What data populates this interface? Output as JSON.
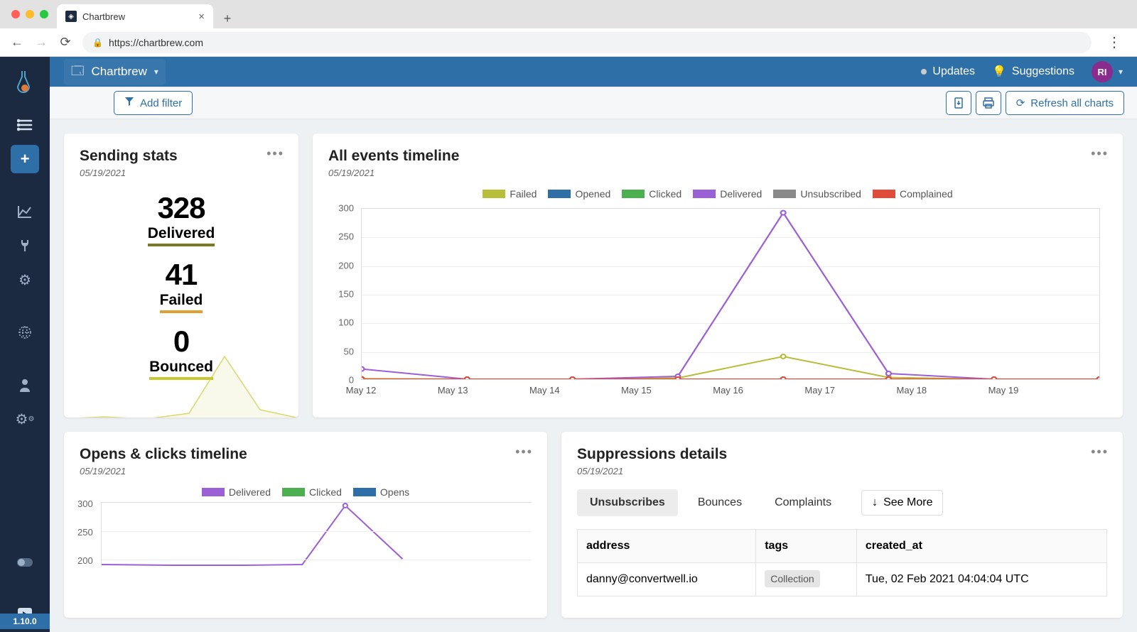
{
  "browser": {
    "tab_title": "Chartbrew",
    "url": "https://chartbrew.com"
  },
  "topbar": {
    "project_name": "Chartbrew",
    "updates_label": "Updates",
    "suggestions_label": "Suggestions",
    "avatar_initials": "RI"
  },
  "toolbar": {
    "add_filter": "Add filter",
    "refresh_label": "Refresh all charts"
  },
  "sidebar": {
    "version": "1.10.0"
  },
  "cards": {
    "sending_stats": {
      "title": "Sending stats",
      "date": "05/19/2021",
      "kpis": [
        {
          "value": "328",
          "label": "Delivered",
          "color": "#7a7a20"
        },
        {
          "value": "41",
          "label": "Failed",
          "color": "#e0a030"
        },
        {
          "value": "0",
          "label": "Bounced",
          "color": "#c8c830"
        }
      ]
    },
    "all_events": {
      "title": "All events timeline",
      "date": "05/19/2021"
    },
    "opens_clicks": {
      "title": "Opens & clicks timeline",
      "date": "05/19/2021",
      "legend": [
        {
          "name": "Delivered",
          "color": "#9b5fd6"
        },
        {
          "name": "Clicked",
          "color": "#4caf50"
        },
        {
          "name": "Opens",
          "color": "#2f6fa7"
        }
      ],
      "yticks": [
        "300",
        "250",
        "200"
      ]
    },
    "suppressions": {
      "title": "Suppressions details",
      "date": "05/19/2021",
      "tabs": [
        "Unsubscribes",
        "Bounces",
        "Complaints"
      ],
      "see_more": "See More",
      "columns": [
        "address",
        "tags",
        "created_at"
      ],
      "rows": [
        {
          "address": "danny@convertwell.io",
          "tag": "Collection",
          "created_at": "Tue, 02 Feb 2021 04:04:04 UTC"
        }
      ]
    }
  },
  "chart_data": {
    "type": "line",
    "title": "All events timeline",
    "categories": [
      "May 12",
      "May 13",
      "May 14",
      "May 15",
      "May 16",
      "May 17",
      "May 18",
      "May 19"
    ],
    "ylim": [
      0,
      300
    ],
    "yticks": [
      0,
      50,
      100,
      150,
      200,
      250,
      300
    ],
    "series": [
      {
        "name": "Failed",
        "color": "#b8bd3a",
        "values": [
          1,
          0,
          0,
          2,
          40,
          3,
          0,
          0
        ]
      },
      {
        "name": "Opened",
        "color": "#2f6fa7",
        "values": [
          0,
          0,
          0,
          0,
          0,
          0,
          0,
          0
        ]
      },
      {
        "name": "Clicked",
        "color": "#4caf50",
        "values": [
          0,
          0,
          0,
          0,
          0,
          0,
          0,
          0
        ]
      },
      {
        "name": "Delivered",
        "color": "#9b5fd6",
        "values": [
          18,
          0,
          0,
          5,
          293,
          10,
          0,
          0
        ]
      },
      {
        "name": "Unsubscribed",
        "color": "#8a8a8a",
        "values": [
          0,
          0,
          0,
          0,
          0,
          0,
          0,
          0
        ]
      },
      {
        "name": "Complained",
        "color": "#e04b3a",
        "values": [
          0,
          0,
          0,
          0,
          0,
          0,
          0,
          0
        ]
      }
    ]
  }
}
